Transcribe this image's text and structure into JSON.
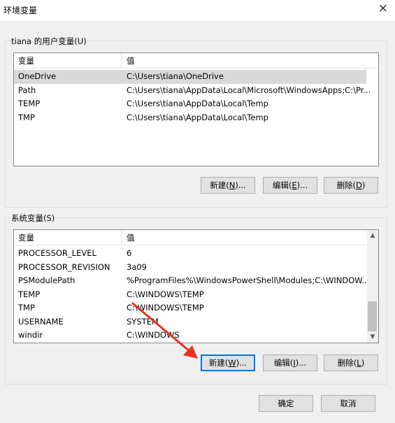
{
  "window": {
    "title": "环境变量",
    "close_icon": "×"
  },
  "user_vars": {
    "group_label": "tiana 的用户变量(U)",
    "header": {
      "name": "变量",
      "value": "值"
    },
    "rows": [
      {
        "name": "OneDrive",
        "value": "C:\\Users\\tiana\\OneDrive"
      },
      {
        "name": "Path",
        "value": "C:\\Users\\tiana\\AppData\\Local\\Microsoft\\WindowsApps;C:\\Pr..."
      },
      {
        "name": "TEMP",
        "value": "C:\\Users\\tiana\\AppData\\Local\\Temp"
      },
      {
        "name": "TMP",
        "value": "C:\\Users\\tiana\\AppData\\Local\\Temp"
      }
    ],
    "buttons": {
      "new": {
        "text": "新建(",
        "key": "N",
        "tail": ")..."
      },
      "edit": {
        "text": "编辑(",
        "key": "E",
        "tail": ")..."
      },
      "delete": {
        "text": "删除(",
        "key": "D",
        "tail": ")"
      }
    }
  },
  "system_vars": {
    "group_label": "系统变量(S)",
    "header": {
      "name": "变量",
      "value": "值"
    },
    "rows": [
      {
        "name": "PROCESSOR_LEVEL",
        "value": "6"
      },
      {
        "name": "PROCESSOR_REVISION",
        "value": "3a09"
      },
      {
        "name": "PSModulePath",
        "value": "%ProgramFiles%\\WindowsPowerShell\\Modules;C:\\WINDOW..."
      },
      {
        "name": "TEMP",
        "value": "C:\\WINDOWS\\TEMP"
      },
      {
        "name": "TMP",
        "value": "C:\\WINDOWS\\TEMP"
      },
      {
        "name": "USERNAME",
        "value": "SYSTEM"
      },
      {
        "name": "windir",
        "value": "C:\\WINDOWS"
      }
    ],
    "buttons": {
      "new": {
        "text": "新建(",
        "key": "W",
        "tail": ")..."
      },
      "edit": {
        "text": "编辑(",
        "key": "I",
        "tail": ")..."
      },
      "delete": {
        "text": "删除(",
        "key": "L",
        "tail": ")"
      }
    }
  },
  "dialog_buttons": {
    "ok": "确定",
    "cancel": "取消"
  },
  "colors": {
    "annotation_arrow": "#e8321f",
    "focus_border": "#0078d7",
    "selection": "#d9d9d9"
  }
}
